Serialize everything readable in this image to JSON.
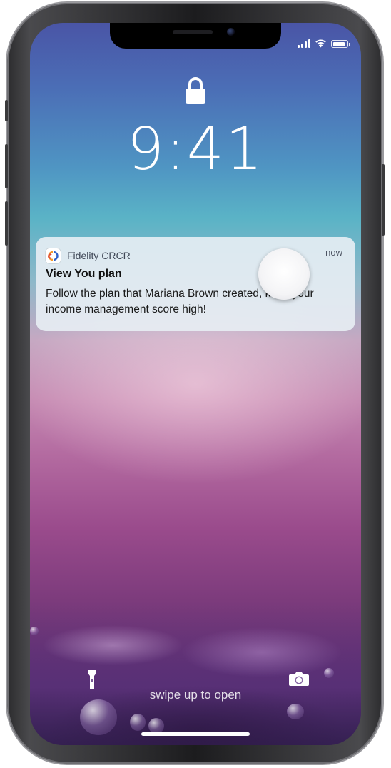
{
  "status_bar": {
    "signal_icon": "cellular-signal-icon",
    "wifi_icon": "wifi-icon",
    "battery_icon": "battery-icon",
    "battery_level": 0.9
  },
  "lock_screen": {
    "lock_icon": "padlock-icon",
    "time": "9:41",
    "swipe_hint": "swipe up to open",
    "flashlight_icon": "flashlight-icon",
    "camera_icon": "camera-icon"
  },
  "notification": {
    "app_name": "Fidelity CRCR",
    "app_icon": "fidelity-app-icon",
    "time": "now",
    "title": "View You plan",
    "body": "Follow the plan that Mariana Brown created, keep your income management score high!"
  },
  "colors": {
    "app_icon_orange": "#f39a2b",
    "app_icon_blue": "#2f63c9",
    "app_icon_red": "#e0463a"
  }
}
